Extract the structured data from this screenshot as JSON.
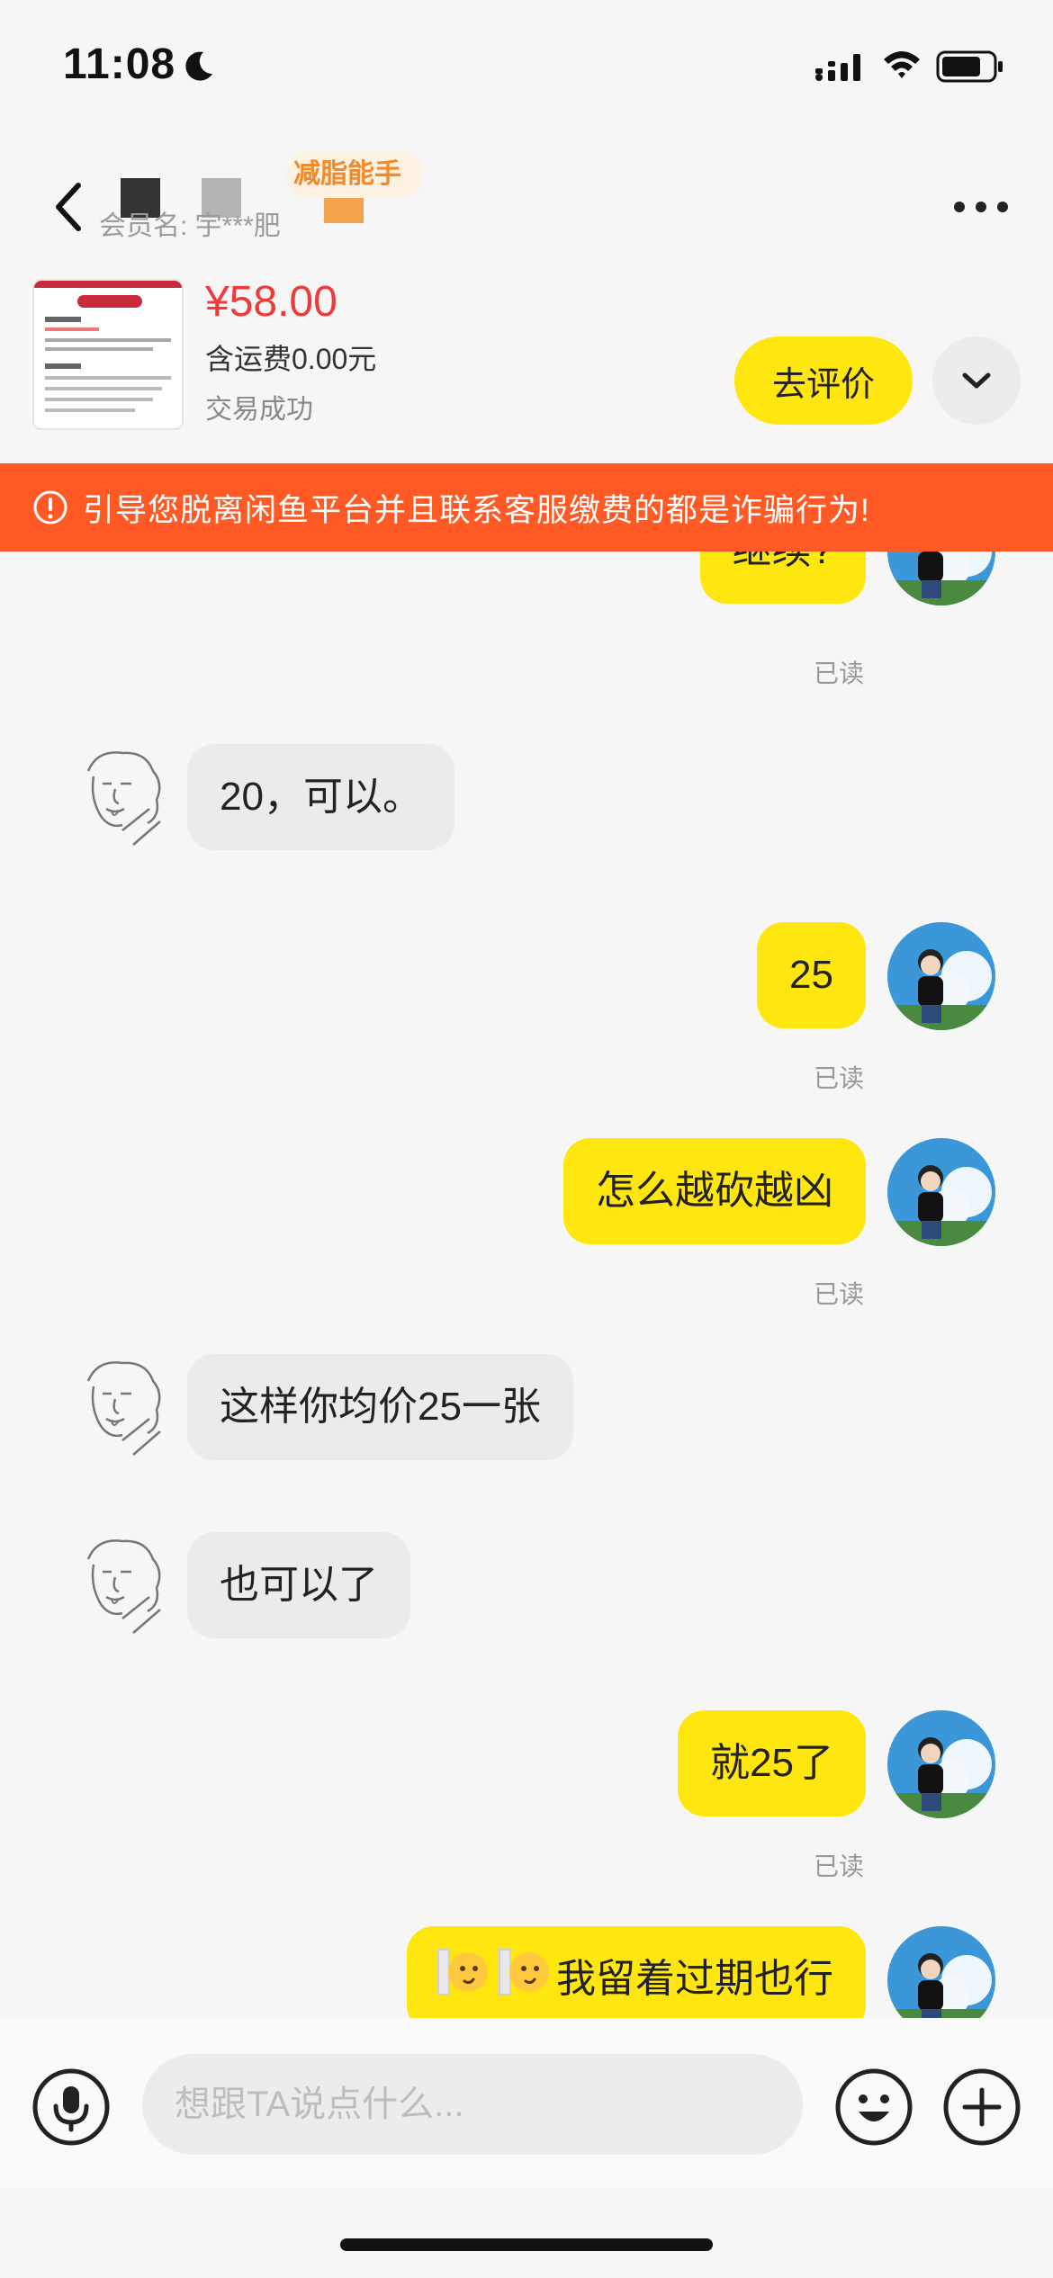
{
  "status_bar": {
    "time": "11:08"
  },
  "header": {
    "badge": "减脂能手",
    "member_label": "会员名: 宇***肥"
  },
  "product": {
    "price": "¥58.00",
    "shipping": "含运费0.00元",
    "status": "交易成功",
    "review_button": "去评价",
    "thumb_title": "缴费详细平台"
  },
  "warning": {
    "text": "引导您脱离闲鱼平台并且联系客服缴费的都是诈骗行为!"
  },
  "messages": [
    {
      "sender": "me",
      "text": "继续?",
      "read": "已读"
    },
    {
      "sender": "them",
      "text": "20，可以。"
    },
    {
      "sender": "me",
      "text": "25",
      "read": "已读"
    },
    {
      "sender": "me",
      "text": "怎么越砍越凶",
      "read": "已读"
    },
    {
      "sender": "them",
      "text": "这样你均价25一张"
    },
    {
      "sender": "them",
      "text": "也可以了"
    },
    {
      "sender": "me",
      "text": "就25了",
      "read": "已读"
    },
    {
      "sender": "me",
      "text": "我留着过期也行",
      "emoji": [
        "peek-emoji",
        "peek-emoji"
      ]
    }
  ],
  "input": {
    "placeholder": "想跟TA说点什么..."
  },
  "colors": {
    "my_bubble": "#ffe60f",
    "their_bubble": "#ebebeb",
    "warning_bg": "#ff5a25",
    "price": "#ee3a3a",
    "badge_text": "#f08a2a"
  }
}
